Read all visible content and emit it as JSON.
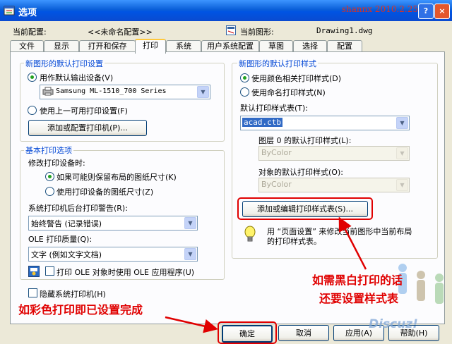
{
  "window": {
    "title": "选项",
    "watermark": "shannx 2010.2.25",
    "help_label": "?",
    "close_label": "×"
  },
  "header": {
    "current_config_label": "当前配置:",
    "current_config_value": "<<未命名配置>>",
    "current_drawing_label": "当前图形:",
    "current_drawing_value": "Drawing1.dwg"
  },
  "tabs": [
    "文件",
    "显示",
    "打开和保存",
    "打印",
    "系统",
    "用户系统配置",
    "草图",
    "选择",
    "配置"
  ],
  "active_tab": "打印",
  "default_device": {
    "title": "新图形的默认打印设置",
    "use_default_label": "用作默认输出设备(V)",
    "printer": "Samsung ML-1510_700 Series",
    "use_last_label": "使用上一可用打印设置(F)",
    "add_config_button": "添加或配置打印机(P)..."
  },
  "basic_options": {
    "title": "基本打印选项",
    "change_device_label": "修改打印设备时:",
    "keep_size_label": "如果可能则保留布局的图纸尺寸(K)",
    "use_device_size_label": "使用打印设备的图纸尺寸(Z)",
    "spooler_label": "系统打印机后台打印警告(R):",
    "spooler_value": "始终警告 (记录错误)",
    "ole_quality_label": "OLE 打印质量(Q):",
    "ole_quality_value": "文字 (例如文字文档)",
    "ole_app_label": "打印 OLE 对象时使用 OLE 应用程序(U)",
    "hide_printers_label": "隐藏系统打印机(H)"
  },
  "plot_style": {
    "title": "新图形的默认打印样式",
    "color_dependent_label": "使用颜色相关打印样式(D)",
    "named_label": "使用命名打印样式(N)",
    "default_table_label": "默认打印样式表(T):",
    "default_table_value": "acad.ctb",
    "layer0_label": "图层 0 的默认打印样式(L):",
    "layer0_value": "ByColor",
    "object_label": "对象的默认打印样式(O):",
    "object_value": "ByColor",
    "add_edit_button": "添加或编辑打印样式表(S)...",
    "info_text_1": "用 “页面设置” 来修改当前图形中当前布局",
    "info_text_2": "的打印样式表。"
  },
  "footer": {
    "ok": "确定",
    "cancel": "取消",
    "apply": "应用(A)",
    "help": "帮助(H)",
    "discuz": "Discuz!"
  },
  "annotations": {
    "color_done": "如彩色打印即已设置完成",
    "bw_line1": "如需黑白打印的话",
    "bw_line2": "还要设置样式表"
  },
  "colors": {
    "annotation": "#e00000",
    "title_bar": "#0054e3",
    "selection": "#316ac5"
  }
}
